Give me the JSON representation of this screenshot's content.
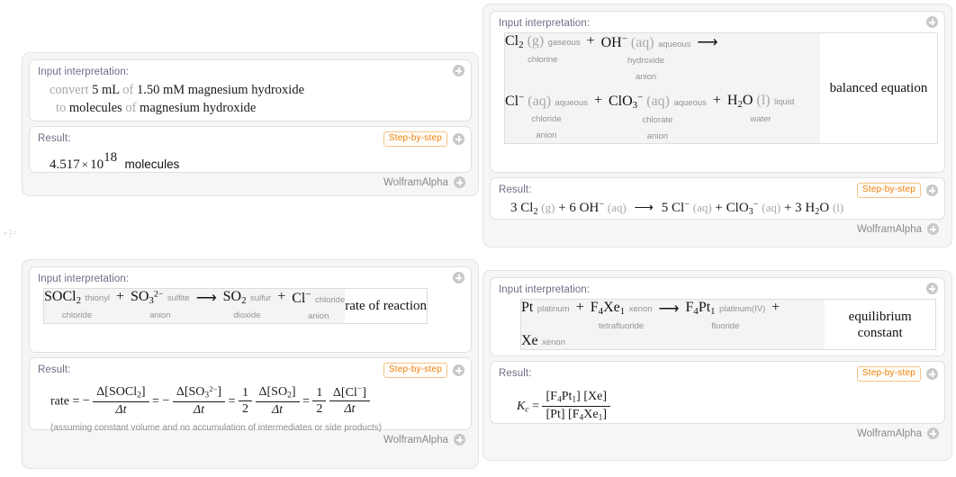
{
  "meta": {
    "cell_marker": "]=",
    "accent_orange": "#f07f09",
    "label_color": "#6f6d86",
    "panel_bg": "#f6f6f6",
    "pod_bg": "#ffffff"
  },
  "labels": {
    "input_interpretation": "Input interpretation:",
    "result": "Result:",
    "step_by_step": "Step-by-step",
    "brand": "WolframAlpha",
    "plus_icon": "plus-circle-icon"
  },
  "panels": {
    "top_left": {
      "name": "unit-conversion-panel",
      "input": {
        "line1": [
          {
            "t": "convert",
            "s": "dim"
          },
          {
            "t": "5 mL",
            "s": "bold"
          },
          {
            "t": "of",
            "s": "dim"
          },
          {
            "t": "1.50 mM magnesium hydroxide",
            "s": "bold"
          }
        ],
        "line2": [
          {
            "t": "to",
            "s": "dim"
          },
          {
            "t": "molecules",
            "s": "bold"
          },
          {
            "t": "of",
            "s": "dim"
          },
          {
            "t": "magnesium hydroxide",
            "s": "bold"
          }
        ]
      },
      "result": {
        "mantissa": "4.517",
        "times": "×",
        "base": "10",
        "exponent": "18",
        "unit": "molecules"
      }
    },
    "top_right": {
      "name": "balanced-equation-panel",
      "input": {
        "row_label": "balanced equation",
        "reactants": [
          {
            "formula": "Cl",
            "sub": "2",
            "state": "(g)",
            "name": "gaseous\nchlorine"
          },
          {
            "formula": "OH",
            "sup": "−",
            "state": "(aq)",
            "name": "aqueous\nhydroxide\nanion"
          }
        ],
        "products": [
          {
            "formula": "Cl",
            "sup": "−",
            "state": "(aq)",
            "name": "aqueous\nchloride\nanion"
          },
          {
            "formula": "ClO",
            "sub": "3",
            "sup": "−",
            "state": "(aq)",
            "name": "aqueous\nchlorate\nanion"
          },
          {
            "formula": "H",
            "sub": "2",
            "tail": "O",
            "state": "(l)",
            "name": "liquid\nwater"
          }
        ],
        "arrow": "⟶",
        "plus": "+"
      },
      "result": {
        "terms": [
          {
            "coef": "3",
            "formula": "Cl",
            "sub": "2",
            "state": "(g)"
          },
          {
            "op": "+",
            "coef": "6",
            "formula": "OH",
            "sup": "−",
            "state": "(aq)"
          },
          {
            "op": "⟶",
            "coef": "5",
            "formula": "Cl",
            "sup": "−",
            "state": "(aq)"
          },
          {
            "op": "+",
            "coef": "",
            "formula": "ClO",
            "sub": "3",
            "sup": "−",
            "state": "(aq)"
          },
          {
            "op": "+",
            "coef": "3",
            "formula": "H",
            "sub": "2",
            "tail": "O",
            "state": "(l)"
          }
        ]
      }
    },
    "bottom_left": {
      "name": "rate-of-reaction-panel",
      "input": {
        "row_label": "rate of reaction",
        "reactants": [
          {
            "formula": "SOCl",
            "sub": "2",
            "name": "thionyl\nchloride"
          },
          {
            "formula": "SO",
            "sub": "3",
            "sup": "2−",
            "name": "sulfite\nanion"
          }
        ],
        "products": [
          {
            "formula": "SO",
            "sub": "2",
            "name": "sulfur\ndioxide"
          },
          {
            "formula": "Cl",
            "sup": "−",
            "name": "chloride\nanion"
          }
        ],
        "arrow": "⟶",
        "plus": "+"
      },
      "result": {
        "lhs": "rate",
        "equals": "=",
        "terms": [
          {
            "sign": "−",
            "coef": "",
            "num_prefix": "Δ[",
            "num_formula": "SOCl",
            "num_sub": "2",
            "num_suffix": "]",
            "den": "Δt"
          },
          {
            "sign": "−",
            "coef": "",
            "num_prefix": "Δ[",
            "num_formula": "SO",
            "num_sub": "3",
            "num_sup": "2−",
            "num_suffix": "]",
            "den": "Δt"
          },
          {
            "sign": "",
            "coef": "1/2",
            "num_prefix": "Δ[",
            "num_formula": "SO",
            "num_sub": "2",
            "num_suffix": "]",
            "den": "Δt"
          },
          {
            "sign": "",
            "coef": "1/2",
            "num_prefix": "Δ[",
            "num_formula": "Cl",
            "num_sup": "−",
            "num_suffix": "]",
            "den": "Δt"
          }
        ],
        "assumption": "(assuming constant volume and no accumulation of intermediates or side products)"
      }
    },
    "bottom_right": {
      "name": "equilibrium-constant-panel",
      "input": {
        "row_label": "equilibrium constant",
        "reactants": [
          {
            "formula": "Pt",
            "name": "platinum"
          },
          {
            "formula": "F",
            "sub": "4",
            "tail": "Xe",
            "tail_sub": "1",
            "name": "xenon\ntetrafluoride"
          }
        ],
        "products": [
          {
            "formula": "F",
            "sub": "4",
            "tail": "Pt",
            "tail_sub": "1",
            "name": "platinum(IV)\nfluoride"
          },
          {
            "formula": "Xe",
            "name": "xenon"
          }
        ],
        "arrow": "⟶",
        "plus": "+"
      },
      "result": {
        "lhs": "K",
        "lhs_sub": "c",
        "equals": "=",
        "numerator": [
          {
            "open": "[",
            "formula": "F",
            "sub": "4",
            "tail": "Pt",
            "tail_sub": "1",
            "close": "]"
          },
          {
            "open": "[",
            "formula": "Xe",
            "close": "]"
          }
        ],
        "denominator": [
          {
            "open": "[",
            "formula": "Pt",
            "close": "]"
          },
          {
            "open": "[",
            "formula": "F",
            "sub": "4",
            "tail": "Xe",
            "tail_sub": "1",
            "close": "]"
          }
        ]
      }
    }
  }
}
